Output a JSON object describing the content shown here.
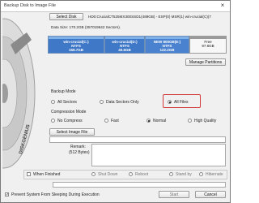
{
  "window": {
    "title": "Backup Disk to Image File",
    "close_glyph": "×"
  },
  "branding": {
    "disc_text": "DISKGENIUS"
  },
  "disk": {
    "select_label": "Select Disk",
    "name": "HD0:CrucialCT525MX300SSD1(489GB)  - ESP(0) MSR(1) win-crucial(C)(7",
    "data_size": "Data Size: 170.2GB (357019642 Sectors)."
  },
  "partitions": [
    {
      "name": "win-crucial(C:)",
      "fs": "NTFS",
      "size": "159.7GB"
    },
    {
      "name": "win-crucial(D:)",
      "fs": "NTFS",
      "size": "40.6GB"
    },
    {
      "name": "NEW 800GB(E:)",
      "fs": "NTFS",
      "size": "122.2GB"
    },
    {
      "name": "Free",
      "fs": "",
      "size": "97.8GB"
    }
  ],
  "manage_partitions_label": "Manage Partitions",
  "backup_mode": {
    "title": "Backup Mode",
    "options": [
      "All Sectors",
      "Data Sectors Only",
      "All Files"
    ],
    "selected": "All Files"
  },
  "compression_mode": {
    "title": "Compression Mode",
    "options": [
      "No Compress",
      "Fast",
      "Normal",
      "High Quality"
    ],
    "selected": "Normal"
  },
  "image_file": {
    "select_label": "Select Image File",
    "value": ""
  },
  "remarks": {
    "label": "Remark:",
    "hint": "(512 Bytes)",
    "value": ""
  },
  "when_finished": {
    "label": "When Finished",
    "checked": false,
    "options": [
      "Shut Down",
      "Reboot",
      "Stand by",
      "Hibernate"
    ],
    "selected": "Shut Down"
  },
  "progress": {
    "value": 0
  },
  "footer": {
    "prevent_sleep_label": "Prevent System From Sleeping During Execution",
    "prevent_sleep_checked": true,
    "start_label": "Start",
    "cancel_label": "Cancel"
  }
}
